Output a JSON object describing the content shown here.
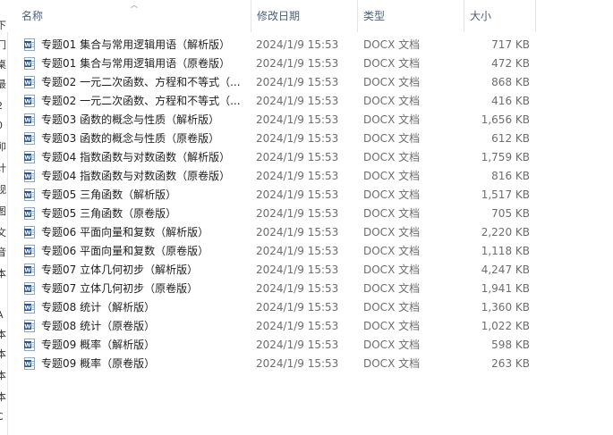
{
  "nav_glyphs": [
    "下",
    "门",
    "桌",
    "最",
    "2",
    "0",
    "卯",
    "计",
    "视",
    "图",
    "文",
    "音",
    "本",
    "A",
    "本",
    "本",
    "本",
    "本",
    "C"
  ],
  "columns": {
    "name": "名称",
    "date": "修改日期",
    "type": "类型",
    "size": "大小"
  },
  "files": [
    {
      "name": "专题01 集合与常用逻辑用语（解析版）",
      "date": "2024/1/9 15:53",
      "type": "DOCX 文档",
      "size": "717 KB"
    },
    {
      "name": "专题01 集合与常用逻辑用语（原卷版）",
      "date": "2024/1/9 15:53",
      "type": "DOCX 文档",
      "size": "472 KB"
    },
    {
      "name": "专题02 一元二次函数、方程和不等式（...",
      "date": "2024/1/9 15:53",
      "type": "DOCX 文档",
      "size": "868 KB"
    },
    {
      "name": "专题02 一元二次函数、方程和不等式（...",
      "date": "2024/1/9 15:53",
      "type": "DOCX 文档",
      "size": "416 KB"
    },
    {
      "name": "专题03 函数的概念与性质（解析版）",
      "date": "2024/1/9 15:53",
      "type": "DOCX 文档",
      "size": "1,656 KB"
    },
    {
      "name": "专题03 函数的概念与性质（原卷版）",
      "date": "2024/1/9 15:53",
      "type": "DOCX 文档",
      "size": "612 KB"
    },
    {
      "name": "专题04 指数函数与对数函数（解析版）",
      "date": "2024/1/9 15:53",
      "type": "DOCX 文档",
      "size": "1,759 KB"
    },
    {
      "name": "专题04 指数函数与对数函数（原卷版）",
      "date": "2024/1/9 15:53",
      "type": "DOCX 文档",
      "size": "816 KB"
    },
    {
      "name": "专题05 三角函数（解析版）",
      "date": "2024/1/9 15:53",
      "type": "DOCX 文档",
      "size": "1,517 KB"
    },
    {
      "name": "专题05 三角函数（原卷版）",
      "date": "2024/1/9 15:53",
      "type": "DOCX 文档",
      "size": "705 KB"
    },
    {
      "name": "专题06 平面向量和复数（解析版）",
      "date": "2024/1/9 15:53",
      "type": "DOCX 文档",
      "size": "2,220 KB"
    },
    {
      "name": "专题06 平面向量和复数（原卷版）",
      "date": "2024/1/9 15:53",
      "type": "DOCX 文档",
      "size": "1,118 KB"
    },
    {
      "name": "专题07 立体几何初步（解析版）",
      "date": "2024/1/9 15:53",
      "type": "DOCX 文档",
      "size": "4,247 KB"
    },
    {
      "name": "专题07 立体几何初步（原卷版）",
      "date": "2024/1/9 15:53",
      "type": "DOCX 文档",
      "size": "1,941 KB"
    },
    {
      "name": "专题08 统计（解析版）",
      "date": "2024/1/9 15:53",
      "type": "DOCX 文档",
      "size": "1,360 KB"
    },
    {
      "name": "专题08 统计（原卷版）",
      "date": "2024/1/9 15:53",
      "type": "DOCX 文档",
      "size": "1,022 KB"
    },
    {
      "name": "专题09 概率（解析版）",
      "date": "2024/1/9 15:53",
      "type": "DOCX 文档",
      "size": "598 KB"
    },
    {
      "name": "专题09 概率（原卷版）",
      "date": "2024/1/9 15:53",
      "type": "DOCX 文档",
      "size": "263 KB"
    }
  ],
  "colors": {
    "header_text": "#4c607a",
    "word_icon_blue": "#2b579a",
    "secondary_text": "#6d6d6d"
  },
  "icons": {
    "file": "word-document-icon",
    "sort": "sort-ascending-icon"
  }
}
